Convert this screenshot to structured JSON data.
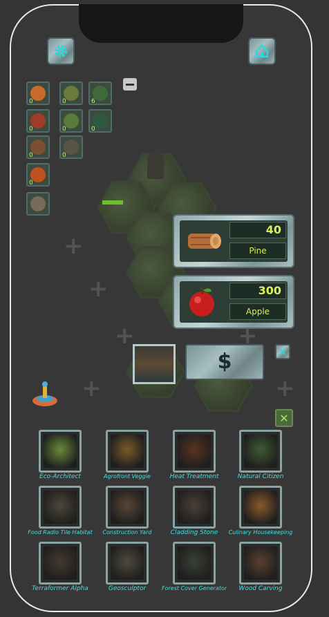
{
  "top_bar": {
    "settings_icon": "gear-icon",
    "home_icon": "home-icon"
  },
  "inventory": [
    {
      "icon": "pumpkin-icon",
      "count": "0"
    },
    {
      "icon": "tree-icon",
      "count": "0"
    },
    {
      "icon": "bush-icon",
      "count": "6"
    },
    {
      "icon": "meat-icon",
      "count": "0"
    },
    {
      "icon": "shrub-icon",
      "count": "0"
    },
    {
      "icon": "leaf-icon",
      "count": "0"
    },
    {
      "icon": "logs-icon",
      "count": "0"
    },
    {
      "icon": "rock-icon",
      "count": "0"
    },
    {
      "icon": "fire-icon",
      "count": "0"
    },
    {
      "icon": "crate-icon",
      "count": ""
    }
  ],
  "resources": [
    {
      "name": "Pine",
      "value": "40",
      "icon": "log-icon"
    },
    {
      "name": "Apple",
      "value": "300",
      "icon": "apple-icon"
    }
  ],
  "sell": {
    "label": "$"
  },
  "buildings": [
    {
      "label": "Eco-Architect",
      "big": true,
      "color": "#6a8a3a"
    },
    {
      "label": "Agrofront Veggie",
      "big": false,
      "color": "#7a5a2a"
    },
    {
      "label": "Heat Treatment",
      "big": true,
      "color": "#5a3320"
    },
    {
      "label": "Natural Citizen",
      "big": true,
      "color": "#3f5a32"
    },
    {
      "label": "Food Radio Tile Habitat",
      "big": false,
      "color": "#4d4738"
    },
    {
      "label": "Construction Yard",
      "big": false,
      "color": "#5a4636"
    },
    {
      "label": "Cladding Stone",
      "big": true,
      "color": "#4a4038"
    },
    {
      "label": "Culinary Housekeeping",
      "big": false,
      "color": "#8a5a2a"
    },
    {
      "label": "Terraformer Alpha",
      "big": true,
      "color": "#453a30"
    },
    {
      "label": "Geosculptor",
      "big": true,
      "color": "#4f4a3c"
    },
    {
      "label": "Forest Cover Generator",
      "big": false,
      "color": "#3a4036"
    },
    {
      "label": "Wood Carving",
      "big": true,
      "color": "#5a4030"
    }
  ]
}
